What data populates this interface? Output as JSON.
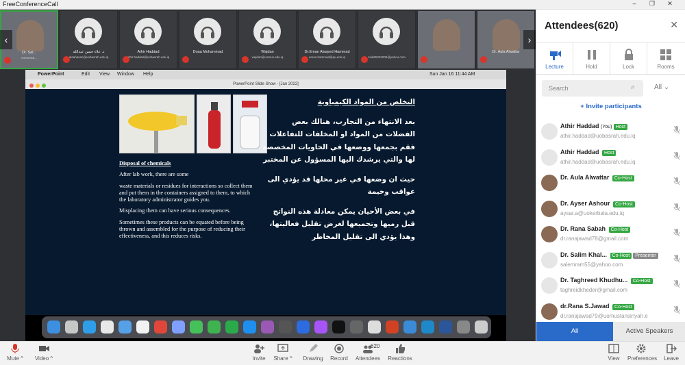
{
  "window": {
    "title": "FreeConferenceCall"
  },
  "strip": {
    "tiles": [
      {
        "name": "Dr. Sal...",
        "email": "emram55...",
        "type": "video"
      },
      {
        "name": "د. علاء حسن عبدالله",
        "email": "alaahasan@uobasrah.edu.iq",
        "type": "icon"
      },
      {
        "name": "Athir Haddad",
        "email": "athir.haddad@uobasrah.edu.iq",
        "type": "icon"
      },
      {
        "name": "Doaa Mohammad",
        "email": "",
        "type": "icon"
      },
      {
        "name": "Wajdan",
        "email": "wajdan@uomus.edu.iq",
        "type": "icon"
      },
      {
        "name": "Dr.Eman Alsayed Hammad",
        "email": "eman.hammad@qu.edu.iq",
        "type": "icon"
      },
      {
        "name": "",
        "email": "zaid65002006@yahoo.com",
        "type": "icon"
      },
      {
        "name": "",
        "email": "",
        "type": "video"
      },
      {
        "name": "Dr. Aula Alwattar",
        "email": "",
        "type": "video"
      }
    ]
  },
  "mac": {
    "app": "PowerPoint",
    "menus": [
      "Edit",
      "View",
      "Window",
      "Help"
    ],
    "clock": "Sun Jan 16  11:44 AM"
  },
  "ppt": {
    "title": "PowerPoint Slide Show - [Jan 2022]"
  },
  "slide": {
    "en_heading": "Disposal of chemicals",
    "en_paragraphs": [
      "After lab work, there are some",
      "waste materials or residues for interactions so collect them and put them in the containers assigned to them, to which the laboratory administrator guides you.",
      "Misplacing them can have serious consequences.",
      "Sometimes these products can be equated before being thrown and assembled for the purpose of reducing their effectiveness, and this reduces risks."
    ],
    "ar_heading": "التخلص من المواد الكيمياوية",
    "ar_paragraphs": [
      "بعد الانتهاء من التجارب، هنالك بعض الفضلات من المواد او المخلفات للتفاعلات فقم بجمعها ووضعها في الحاويات المخصصة لها والتي يرشدك اليها المسؤول عن المختبر",
      "حيث ان وضعها في غير محلها قد يؤدي الى عواقب وخيمة",
      "في بعض الأحيان يمكن معادلة هذه النواتج قبل رميها وتجميعها لغرض تقليل فعاليتها، وهذا يؤدي الى تقليل المخاطر"
    ]
  },
  "panel": {
    "title": "Attendees(620)",
    "controls": [
      "Lecture",
      "Hold",
      "Lock",
      "Rooms"
    ],
    "search_placeholder": "Search",
    "filter": "All",
    "invite": "Invite participants",
    "attendees": [
      {
        "name": "Athir Haddad",
        "you": "(You)",
        "badge": "Host",
        "email": "athir.haddad@uobasrah.edu.iq",
        "photo": false
      },
      {
        "name": "Athir Haddad",
        "you": "",
        "badge": "Host",
        "email": "athir.haddad@uobasrah.edu.iq",
        "photo": false
      },
      {
        "name": "Dr. Aula Alwattar",
        "you": "",
        "badge": "Co-Host",
        "email": "",
        "photo": true
      },
      {
        "name": "Dr. Ayser Ashour",
        "you": "",
        "badge": "Co-Host",
        "email": "aysar.a@uokerbala.edu.iq",
        "photo": true
      },
      {
        "name": "Dr. Rana Sabah",
        "you": "",
        "badge": "Co-Host",
        "email": "dr.ranajawad78@gmail.com",
        "photo": true
      },
      {
        "name": "Dr. Salim Khal...",
        "you": "",
        "badge": "Co-Host",
        "badge2": "Presenter",
        "email": "salemram55@yahoo.com",
        "photo": false
      },
      {
        "name": "Dr. Taghreed Khudhu...",
        "you": "",
        "badge": "Co-Host",
        "email": "taghreidkheder@gmail.com",
        "photo": false
      },
      {
        "name": "dr.Rana S.Jawad",
        "you": "",
        "badge": "Co-Host",
        "email": "dr.ranajawad79@uomustansiriyah.e",
        "photo": true
      }
    ],
    "tabs": [
      "All",
      "Active Speakers"
    ]
  },
  "toolbar": {
    "mute": "Mute",
    "video": "Video",
    "invite": "Invite",
    "share": "Share",
    "drawing": "Drawing",
    "record": "Record",
    "attendees": "Attendees",
    "attendees_count": "620",
    "reactions": "Reactions",
    "view": "View",
    "preferences": "Preferences",
    "leave": "Leave"
  },
  "colors": {
    "accent": "#2a6ac9",
    "host_badge": "#35a743",
    "mic_off": "#d9342b"
  }
}
